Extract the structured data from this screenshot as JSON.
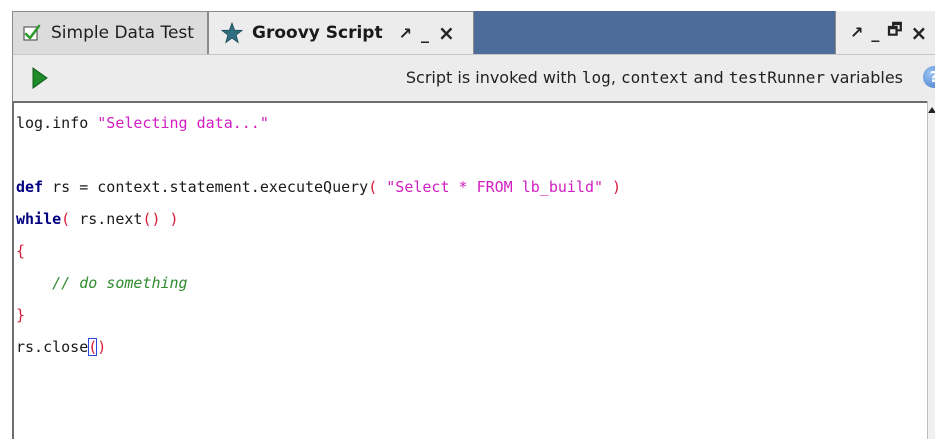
{
  "tabs": [
    {
      "label": "Simple Data Test",
      "icon": "checkbox-check-icon",
      "active": false
    },
    {
      "label": "Groovy Script",
      "icon": "star-icon",
      "active": true
    }
  ],
  "tab_controls": {
    "pin": "↗",
    "minimize": "_",
    "close": "×",
    "restore": "🗗"
  },
  "toolbar": {
    "run_icon": "run-icon",
    "info_prefix": "Script is invoked with ",
    "var1": "log",
    "sep1": ", ",
    "var2": "context",
    "sep2": " and ",
    "var3": "testRunner",
    "info_suffix": " variables",
    "help_icon": "help-icon"
  },
  "editor": {
    "line1": {
      "code": "log.info ",
      "str": "\"Selecting data...\""
    },
    "line3": {
      "kw": "def",
      "a": " rs = context.statement.executeQuery",
      "p1": "(",
      "sp1": " ",
      "str": "\"Select * FROM lb_build\"",
      "sp2": " ",
      "p2": ")"
    },
    "line4": {
      "kw": "while",
      "p1": "(",
      "a": " rs.next",
      "p2": "()",
      "sp": " ",
      "p3": ")"
    },
    "line5": {
      "brace": "{"
    },
    "line6": {
      "comment": "// do something"
    },
    "line7": {
      "brace": "}"
    },
    "line8": {
      "code": "rs.close",
      "p1": "(",
      "p2": ")"
    }
  },
  "colors": {
    "tab_bar": "#4d6c9a",
    "keyword": "#000080",
    "string": "#d11ec1",
    "paren": "#d81a3a",
    "comment": "#2e8b2e"
  }
}
